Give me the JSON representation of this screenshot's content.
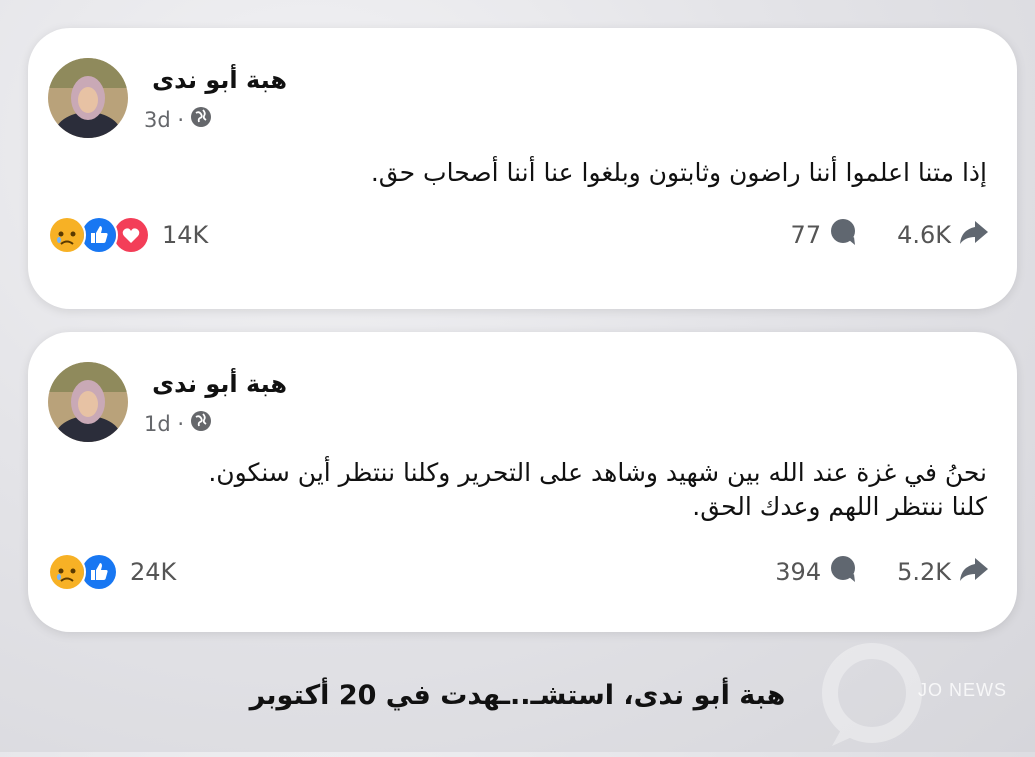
{
  "posts": [
    {
      "author": "هبة أبو ندى",
      "time": "3d ·",
      "text": "إذا متنا اعلموا أننا راضون وثابتون وبلغوا عنا أننا أصحاب حق.",
      "reaction_count": "14K",
      "reactions": [
        "sad-icon",
        "like-icon",
        "love-icon"
      ],
      "comments": "77",
      "shares": "4.6K"
    },
    {
      "author": "هبة أبو ندى",
      "time": "1d ·",
      "text_line1": "نحنُ في غزة عند الله بين شهيد وشاهد على التحرير وكلنا ننتظر أين سنكون.",
      "text_line2": "كلنا ننتظر اللهم وعدك الحق.",
      "reaction_count": "24K",
      "reactions": [
        "sad-icon",
        "like-icon"
      ],
      "comments": "394",
      "shares": "5.2K"
    }
  ],
  "caption": "هبة أبو ندى، استشـ..ـهدت في 20 أكتوبر",
  "watermark": "JO NEWS",
  "colors": {
    "like": "#1877f2",
    "love": "#f33e58",
    "sad": "#f7b125",
    "meta": "#65676b"
  }
}
